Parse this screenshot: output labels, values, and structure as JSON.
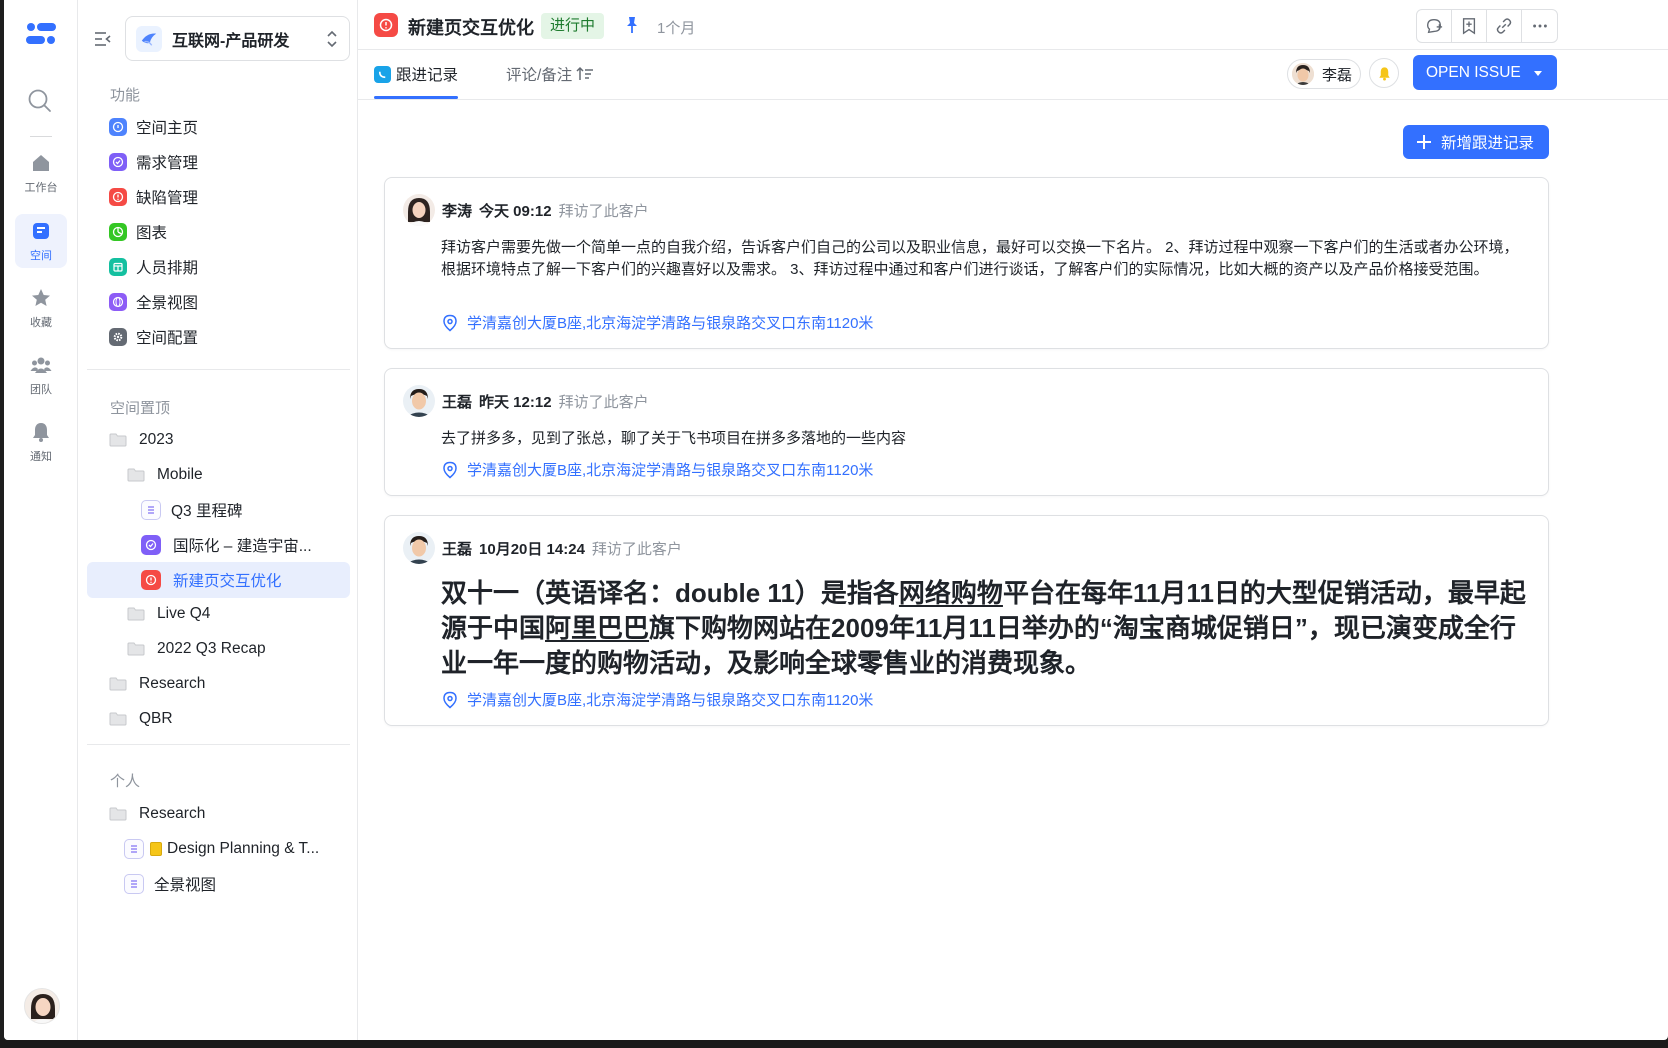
{
  "rail": {
    "workbench_label": "工作台",
    "space_label": "空间",
    "favorites_label": "收藏",
    "team_label": "团队",
    "notify_label": "通知"
  },
  "sidebar": {
    "space_name": "互联网-产品研发",
    "section_features": "功能",
    "features": [
      {
        "label": "空间主页",
        "color": "#4e83fd"
      },
      {
        "label": "需求管理",
        "color": "#7f5ff7"
      },
      {
        "label": "缺陷管理",
        "color": "#f54a45"
      },
      {
        "label": "图表",
        "color": "#34c724"
      },
      {
        "label": "人员排期",
        "color": "#14c0a0"
      },
      {
        "label": "全景视图",
        "color": "#8d5cf6"
      },
      {
        "label": "空间配置",
        "color": "#646a73"
      }
    ],
    "section_pinned": "空间置顶",
    "pinned": [
      {
        "label": "2023"
      },
      {
        "label": "Mobile"
      },
      {
        "label": "Q3 里程碑"
      },
      {
        "label": "国际化 – 建造宇宙..."
      },
      {
        "label": "新建页交互优化"
      },
      {
        "label": "Live Q4"
      },
      {
        "label": "2022 Q3 Recap"
      },
      {
        "label": "Research"
      },
      {
        "label": "QBR"
      }
    ],
    "section_personal": "个人",
    "personal": [
      {
        "label": "Research"
      },
      {
        "label": "Design Planning & T..."
      },
      {
        "label": "全景视图"
      }
    ]
  },
  "header": {
    "title": "新建页交互优化",
    "status": "进行中",
    "status_color": "#e4f5e6",
    "duration": "1个月"
  },
  "tabs": [
    {
      "label": "跟进记录"
    },
    {
      "label": "评论/备注"
    }
  ],
  "assignee": {
    "name": "李磊"
  },
  "open_button": {
    "label": "OPEN ISSUE"
  },
  "add_button": {
    "label": "新增跟进记录"
  },
  "records": [
    {
      "author": "李涛",
      "time": "今天 09:12",
      "action": "拜访了此客户",
      "content": "拜访客户需要先做一个简单一点的自我介绍，告诉客户们自己的公司以及职业信息，最好可以交换一下名片。 2、拜访过程中观察一下客户们的生活或者办公环境，根据环境特点了解一下客户们的兴趣喜好以及需求。 3、拜访过程中通过和客户们进行谈话，了解客户们的实际情况，比如大概的资产以及产品价格接受范围。",
      "location": "学清嘉创大厦B座,北京海淀学清路与银泉路交叉口东南1120米"
    },
    {
      "author": "王磊",
      "time": "昨天 12:12",
      "action": "拜访了此客户",
      "content": "去了拼多多，见到了张总，聊了关于飞书项目在拼多多落地的一些内容",
      "location": "学清嘉创大厦B座,北京海淀学清路与银泉路交叉口东南1120米"
    },
    {
      "author": "王磊",
      "time": "10月20日 14:24",
      "action": "拜访了此客户",
      "content_parts": [
        "双十一（英语译名：double 11）是指各",
        "网络购物",
        "平台在每年11月11日的大型促销活动，最早起源于中国",
        "阿里巴巴",
        "旗下购物网站在2009年11月11日举办的“淘宝商城促销日”，现已演变成全行业一年一度的购物活动，及影响全球零售业的消费现象。"
      ],
      "location": "学清嘉创大厦B座,北京海淀学清路与银泉路交叉口东南1120米"
    }
  ],
  "colors": {
    "accent": "#3370ff",
    "danger": "#f54a45"
  }
}
